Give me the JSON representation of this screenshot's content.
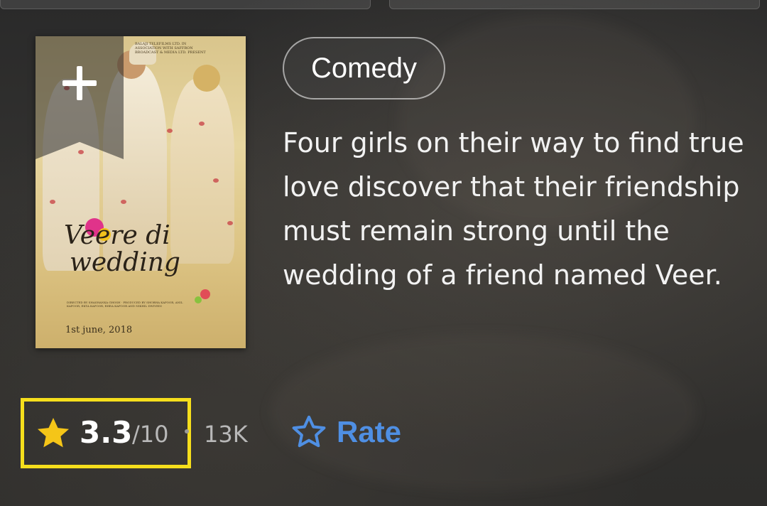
{
  "poster": {
    "title_line1": "Veere di",
    "title_line2": "wedding",
    "release_date": "1st june, 2018",
    "studio_text": "BALAJI TELEFILMS LTD. IN ASSOCIATION WITH SAFFRON BROADCAST & MEDIA LTD. PRESENT",
    "credits_text": "DIRECTED BY SHASHANKA GHOSH · PRODUCED BY SHOBHA KAPOOR, ANIL KAPOOR, EKTA KAPOOR, RHEA KAPOOR AND NIKHIL DWIVEDI",
    "watchlist_icon": "plus-icon"
  },
  "genre": {
    "label": "Comedy"
  },
  "plot": {
    "text": "Four girls on their way to find true love discover that their friendship must remain strong until the wedding of a friend named Veer."
  },
  "rating": {
    "value": "3.3",
    "scale": "/10",
    "count": "13K",
    "star_color": "#f5c518",
    "highlight_color": "#f5de1c"
  },
  "rate": {
    "label": "Rate",
    "icon": "star-outline-icon",
    "color": "#4f8fe3"
  }
}
